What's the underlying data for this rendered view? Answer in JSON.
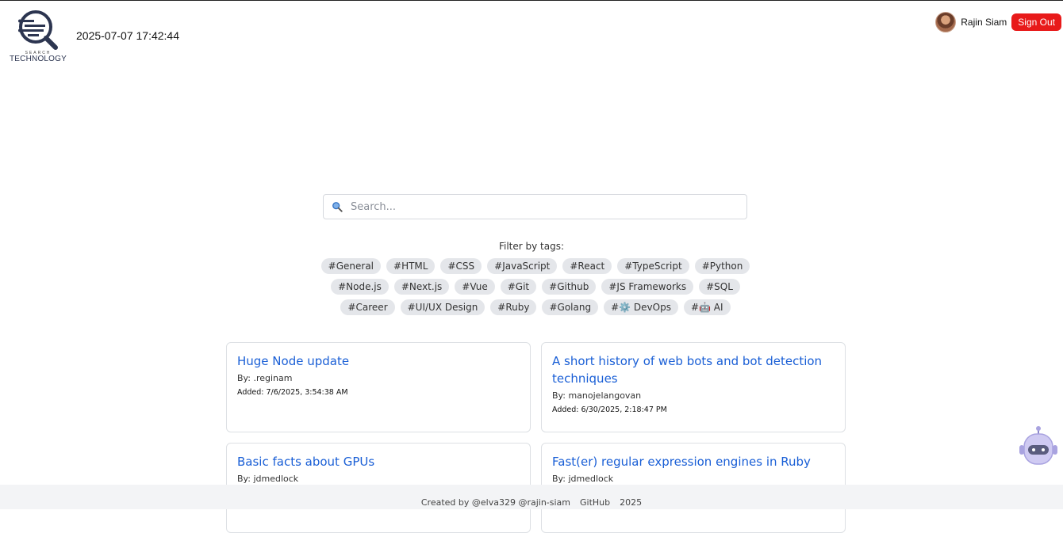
{
  "header": {
    "logo_small": "SEARCH",
    "logo_big": "TECHNOLOGY",
    "datetime": "2025-07-07 17:42:44",
    "user_name": "Rajin Siam",
    "signout_label": "Sign Out"
  },
  "search": {
    "placeholder": "Search..."
  },
  "filter": {
    "label": "Filter by tags:",
    "rows": [
      [
        "#General",
        "#HTML",
        "#CSS",
        "#JavaScript",
        "#React",
        "#TypeScript",
        "#Python"
      ],
      [
        "#Node.js",
        "#Next.js",
        "#Vue",
        "#Git",
        "#Github",
        "#JS Frameworks",
        "#SQL"
      ],
      [
        "#Career",
        "#UI/UX Design",
        "#Ruby",
        "#Golang",
        "#⚙️ DevOps",
        "#🤖 AI"
      ]
    ]
  },
  "articles": [
    {
      "title": "Huge Node update",
      "by": "By: .reginam",
      "added": "Added: 7/6/2025, 3:54:38 AM"
    },
    {
      "title": "A short history of web bots and bot detection techniques",
      "by": "By: manojelangovan",
      "added": "Added: 6/30/2025, 2:18:47 PM"
    },
    {
      "title": "Basic facts about GPUs",
      "by": "By: jdmedlock",
      "added": ""
    },
    {
      "title": "Fast(er) regular expression engines in Ruby",
      "by": "By: jdmedlock",
      "added": ""
    }
  ],
  "footer": {
    "created_by": "Created by @elva329 @rajin-siam",
    "github": "GitHub",
    "year": "2025"
  },
  "colors": {
    "accent": "#1a5fd6",
    "signout": "#e81a1a",
    "tag_bg": "#e4e6ea"
  },
  "icons": {
    "search": "magnifier-icon",
    "chatbot": "robot-icon"
  }
}
